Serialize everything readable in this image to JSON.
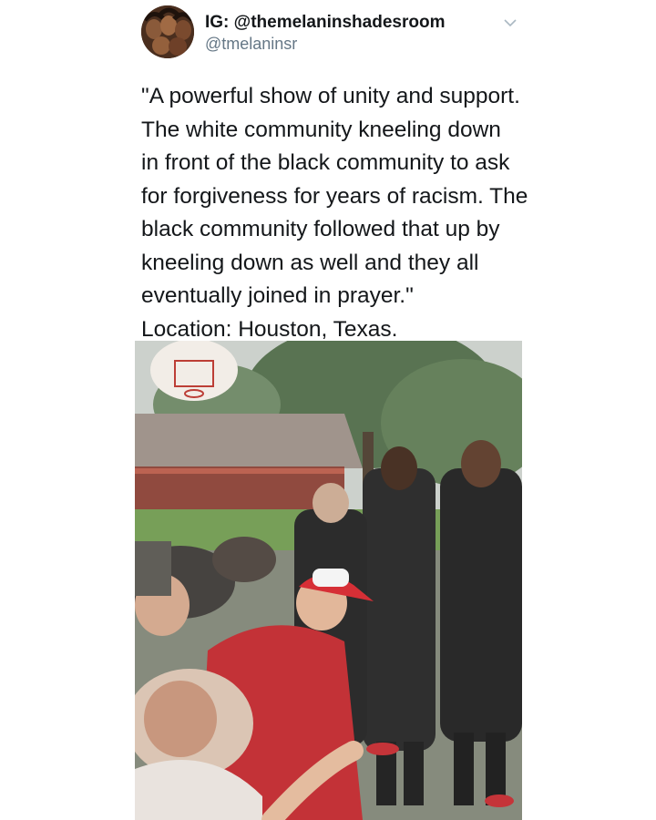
{
  "tweet": {
    "display_name": "IG: @themelaninshadesroom",
    "handle": "@tmelaninsr",
    "text_lines": [
      "\"A powerful show of unity and support.",
      "The white community kneeling down",
      "in front of the black community to ask",
      "for forgiveness for years of racism. The",
      "black community followed that up by",
      "kneeling down as well and they all",
      "eventually joined in prayer.\"",
      "Location: Houston, Texas."
    ]
  },
  "icons": {
    "menu": "chevron-down-icon"
  },
  "colors": {
    "text": "#14171a",
    "secondary": "#657786",
    "background": "#ffffff"
  }
}
